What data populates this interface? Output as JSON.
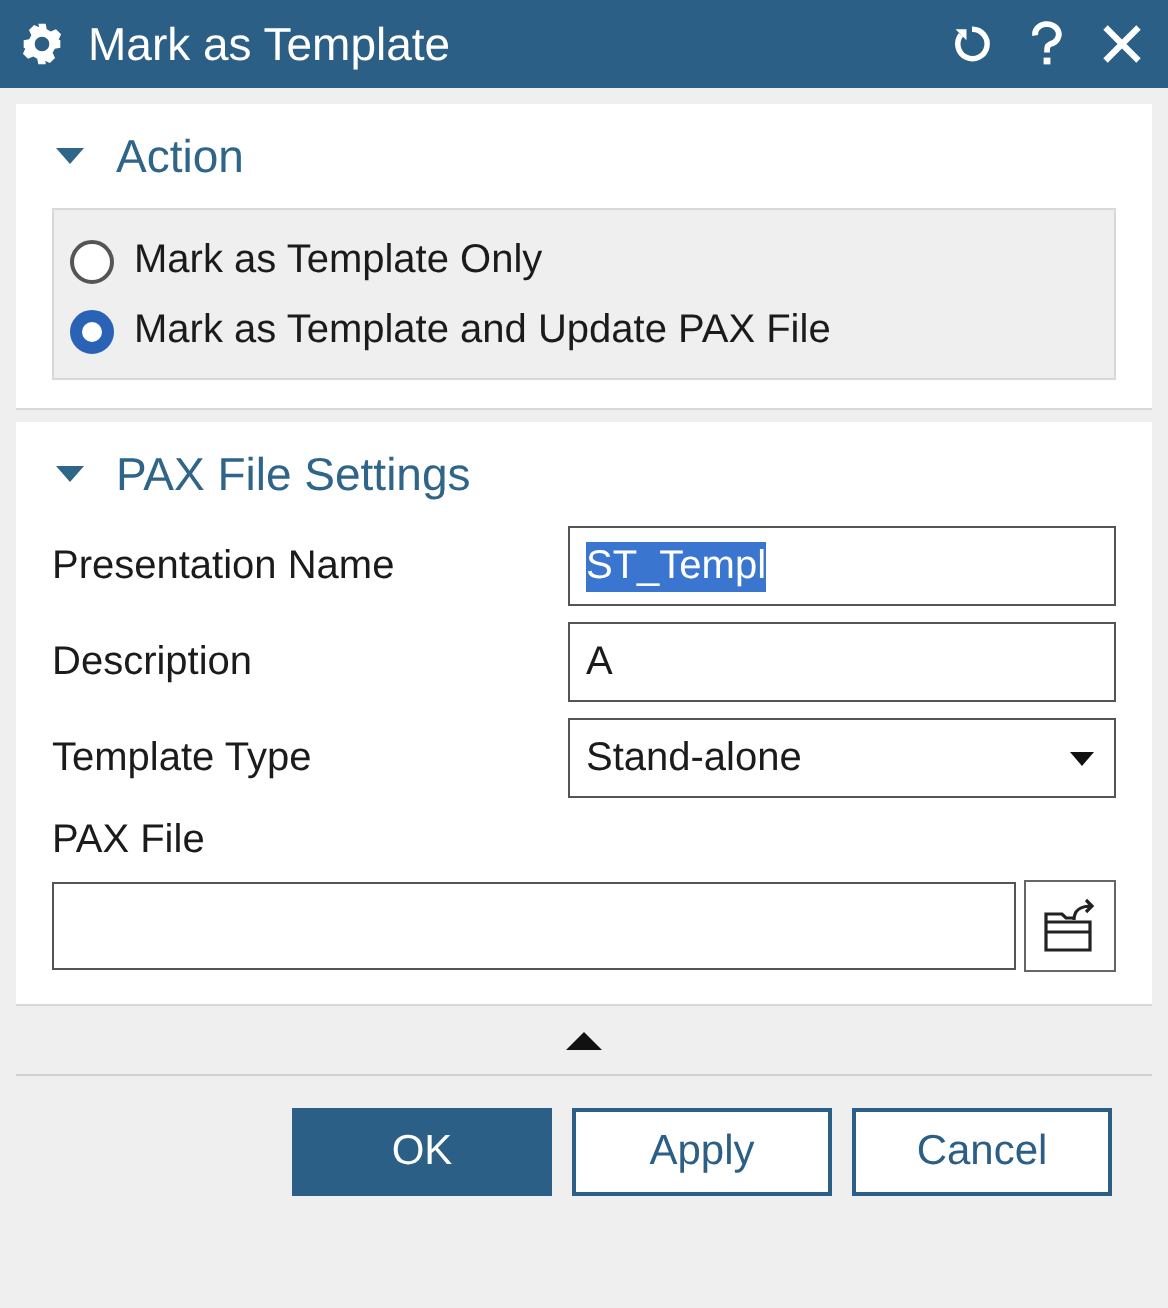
{
  "window": {
    "title": "Mark as Template"
  },
  "action_section": {
    "title": "Action",
    "expanded": true,
    "options": [
      {
        "label": "Mark as Template Only",
        "selected": false
      },
      {
        "label": "Mark as Template and Update PAX File",
        "selected": true
      }
    ]
  },
  "pax_section": {
    "title": "PAX File Settings",
    "expanded": true,
    "fields": [
      {
        "kind": "text",
        "label": "Presentation Name",
        "value": "ST_Templ",
        "text_selected": true
      },
      {
        "kind": "text",
        "label": "Description",
        "value": "A",
        "text_selected": false
      },
      {
        "kind": "dropdown",
        "label": "Template Type",
        "value": "Stand-alone"
      }
    ],
    "pax_file": {
      "label": "PAX File"
    }
  },
  "buttons": [
    {
      "label": "OK",
      "default": true
    },
    {
      "label": "Apply",
      "default": false
    },
    {
      "label": "Cancel",
      "default": false
    }
  ]
}
